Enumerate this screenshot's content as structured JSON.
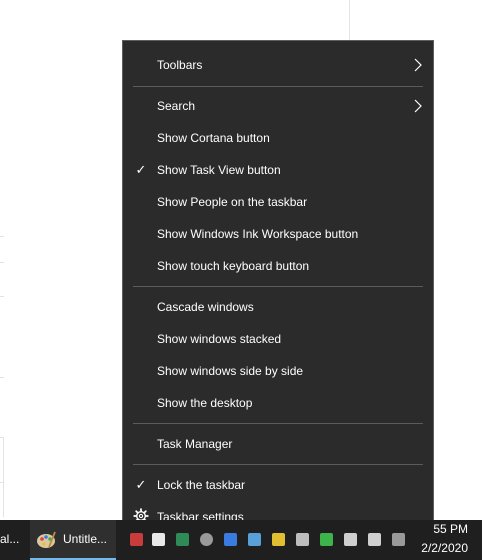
{
  "context_menu": {
    "items": [
      {
        "label": "Toolbars",
        "checked": false,
        "submenu": true
      },
      {
        "label": "Search",
        "checked": false,
        "submenu": true
      },
      {
        "label": "Show Cortana button",
        "checked": false,
        "submenu": false
      },
      {
        "label": "Show Task View button",
        "checked": true,
        "submenu": false
      },
      {
        "label": "Show People on the taskbar",
        "checked": false,
        "submenu": false
      },
      {
        "label": "Show Windows Ink Workspace button",
        "checked": false,
        "submenu": false
      },
      {
        "label": "Show touch keyboard button",
        "checked": false,
        "submenu": false
      },
      {
        "label": "Cascade windows",
        "checked": false,
        "submenu": false
      },
      {
        "label": "Show windows stacked",
        "checked": false,
        "submenu": false
      },
      {
        "label": "Show windows side by side",
        "checked": false,
        "submenu": false
      },
      {
        "label": "Show the desktop",
        "checked": false,
        "submenu": false
      },
      {
        "label": "Task Manager",
        "checked": false,
        "submenu": false
      },
      {
        "label": "Lock the taskbar",
        "checked": true,
        "submenu": false
      },
      {
        "label": "Taskbar settings",
        "checked": false,
        "submenu": false,
        "icon": "gear-icon"
      }
    ],
    "check_glyph": "✓"
  },
  "taskbar": {
    "apps": [
      {
        "label": "al...",
        "icon": "app-icon"
      },
      {
        "label": "Untitle...",
        "icon": "paint-icon"
      }
    ],
    "tray_icons": [
      "mail-icon",
      "file-icon",
      "excel-icon",
      "disk-icon",
      "cloud-icon",
      "folder-icon",
      "warning-icon",
      "usb-icon",
      "chevron-icon",
      "network-icon",
      "speaker-icon"
    ],
    "clock": {
      "time": "55 PM",
      "date": "2/2/2020"
    }
  },
  "colors": {
    "menu_bg": "#2b2b2b",
    "menu_text": "#ffffff",
    "separator": "#5b5b5b",
    "taskbar_bg": "#1f1f1f",
    "active_app_underline": "#76b9ed"
  }
}
